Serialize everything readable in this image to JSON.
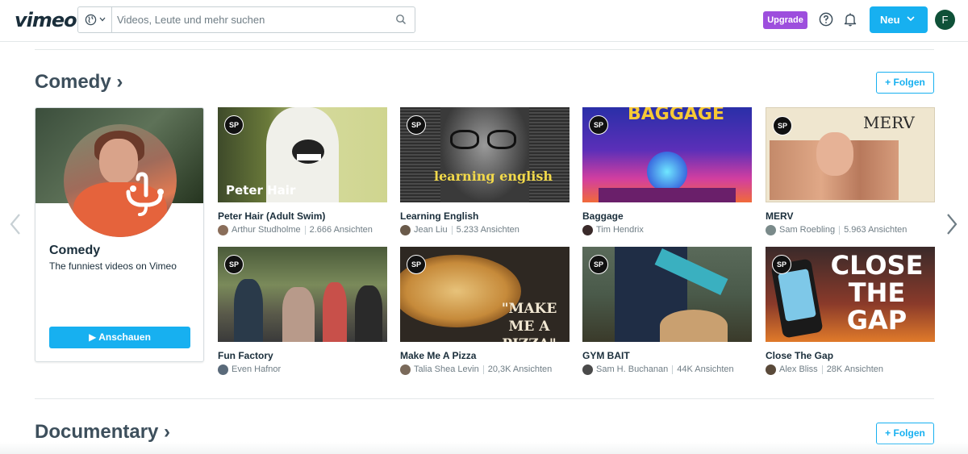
{
  "header": {
    "logo": "vimeo",
    "search_placeholder": "Videos, Leute und mehr suchen",
    "upgrade_label": "Upgrade",
    "new_label": "Neu",
    "avatar_initial": "F"
  },
  "sections": [
    {
      "title": "Comedy ›",
      "follow_label": "+ Folgen"
    },
    {
      "title": "Documentary ›",
      "follow_label": "+ Folgen"
    }
  ],
  "category_card": {
    "name": "Comedy",
    "description": "The funniest videos on Vimeo",
    "watch_label": "▶ Anschauen"
  },
  "badge": "SP",
  "videos": [
    {
      "title": "Peter Hair (Adult Swim)",
      "author": "Arthur Studholme",
      "views": "2.666 Ansichten",
      "thumb_text": "Peter Hair"
    },
    {
      "title": "Learning English",
      "author": "Jean Liu",
      "views": "5.233 Ansichten",
      "thumb_text": "learning english"
    },
    {
      "title": "Baggage",
      "author": "Tim Hendrix",
      "views": "",
      "thumb_text": "BAGGAGE"
    },
    {
      "title": "MERV",
      "author": "Sam Roebling",
      "views": "5.963 Ansichten",
      "thumb_text": "MERV"
    },
    {
      "title": "Fun Factory",
      "author": "Even Hafnor",
      "views": "",
      "thumb_text": ""
    },
    {
      "title": "Make Me A Pizza",
      "author": "Talia Shea Levin",
      "views": "20,3K Ansichten",
      "thumb_text": "\"MAKE ME A PIZZA\""
    },
    {
      "title": "GYM BAIT",
      "author": "Sam H. Buchanan",
      "views": "44K Ansichten",
      "thumb_text": ""
    },
    {
      "title": "Close The Gap",
      "author": "Alex Bliss",
      "views": "28K Ansichten",
      "thumb_text": "CLOSE THE GAP"
    }
  ],
  "colors": {
    "accent": "#17b0f0",
    "upgrade": "#9d4edd",
    "avatar": "#0f5138"
  }
}
